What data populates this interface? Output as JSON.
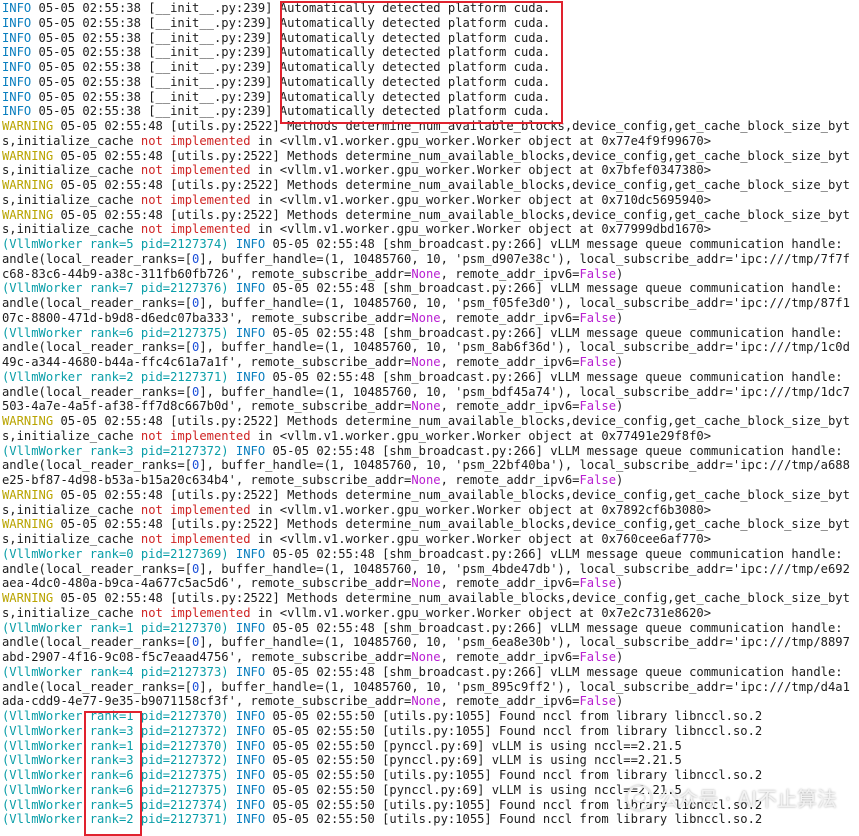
{
  "colors": {
    "default": "#1d1d1d",
    "info": "#0a7fbf",
    "warning": "#b9a400",
    "worker": "#0a9ea8",
    "not_implemented": "#cf2424",
    "number": "#1c50d8",
    "none_false": "#b81fd1",
    "highlight_box": "#e0222e"
  },
  "terminal_lines": [
    [
      [
        "c-info",
        "INFO"
      ],
      [
        "c-default",
        " 05-05 02:55:38 [__init__.py:239] Automatically detected platform cuda."
      ]
    ],
    [
      [
        "c-info",
        "INFO"
      ],
      [
        "c-default",
        " 05-05 02:55:38 [__init__.py:239] Automatically detected platform cuda."
      ]
    ],
    [
      [
        "c-info",
        "INFO"
      ],
      [
        "c-default",
        " 05-05 02:55:38 [__init__.py:239] Automatically detected platform cuda."
      ]
    ],
    [
      [
        "c-info",
        "INFO"
      ],
      [
        "c-default",
        " 05-05 02:55:38 [__init__.py:239] Automatically detected platform cuda."
      ]
    ],
    [
      [
        "c-info",
        "INFO"
      ],
      [
        "c-default",
        " 05-05 02:55:38 [__init__.py:239] Automatically detected platform cuda."
      ]
    ],
    [
      [
        "c-info",
        "INFO"
      ],
      [
        "c-default",
        " 05-05 02:55:38 [__init__.py:239] Automatically detected platform cuda."
      ]
    ],
    [
      [
        "c-info",
        "INFO"
      ],
      [
        "c-default",
        " 05-05 02:55:38 [__init__.py:239] Automatically detected platform cuda."
      ]
    ],
    [
      [
        "c-info",
        "INFO"
      ],
      [
        "c-default",
        " 05-05 02:55:38 [__init__.py:239] Automatically detected platform cuda."
      ]
    ],
    [
      [
        "c-warn",
        "WARNING"
      ],
      [
        "c-default",
        " 05-05 02:55:48 [utils.py:2522] Methods determine_num_available_blocks,device_config,get_cache_block_size_byt"
      ]
    ],
    [
      [
        "c-default",
        "s,initialize_cache "
      ],
      [
        "c-red",
        "not implemented"
      ],
      [
        "c-default",
        " in <vllm.v1.worker.gpu_worker.Worker object at 0x77e4f9f99670>"
      ]
    ],
    [
      [
        "c-warn",
        "WARNING"
      ],
      [
        "c-default",
        " 05-05 02:55:48 [utils.py:2522] Methods determine_num_available_blocks,device_config,get_cache_block_size_byt"
      ]
    ],
    [
      [
        "c-default",
        "s,initialize_cache "
      ],
      [
        "c-red",
        "not implemented"
      ],
      [
        "c-default",
        " in <vllm.v1.worker.gpu_worker.Worker object at 0x7bfef0347380>"
      ]
    ],
    [
      [
        "c-warn",
        "WARNING"
      ],
      [
        "c-default",
        " 05-05 02:55:48 [utils.py:2522] Methods determine_num_available_blocks,device_config,get_cache_block_size_byt"
      ]
    ],
    [
      [
        "c-default",
        "s,initialize_cache "
      ],
      [
        "c-red",
        "not implemented"
      ],
      [
        "c-default",
        " in <vllm.v1.worker.gpu_worker.Worker object at 0x710dc5695940>"
      ]
    ],
    [
      [
        "c-warn",
        "WARNING"
      ],
      [
        "c-default",
        " 05-05 02:55:48 [utils.py:2522] Methods determine_num_available_blocks,device_config,get_cache_block_size_byt"
      ]
    ],
    [
      [
        "c-default",
        "s,initialize_cache "
      ],
      [
        "c-red",
        "not implemented"
      ],
      [
        "c-default",
        " in <vllm.v1.worker.gpu_worker.Worker object at 0x77999dbd1670>"
      ]
    ],
    [
      [
        "c-worker",
        "(VllmWorker rank=5 pid=2127374)"
      ],
      [
        "c-default",
        " "
      ],
      [
        "c-info",
        "INFO"
      ],
      [
        "c-default",
        " 05-05 02:55:48 [shm_broadcast.py:266] vLLM message queue communication handle:"
      ]
    ],
    [
      [
        "c-default",
        "andle(local_reader_ranks=["
      ],
      [
        "c-num",
        "0"
      ],
      [
        "c-default",
        "], buffer_handle=(1, 10485760, 10, 'psm_d907e38c'), local_subscribe_addr='ipc:///tmp/7f7f"
      ]
    ],
    [
      [
        "c-default",
        "c68-83c6-44b9-a38c-311fb60fb726', remote_subscribe_addr="
      ],
      [
        "c-mag",
        "None"
      ],
      [
        "c-default",
        ", remote_addr_ipv6="
      ],
      [
        "c-mag",
        "False"
      ],
      [
        "c-default",
        ")"
      ]
    ],
    [
      [
        "c-worker",
        "(VllmWorker rank=7 pid=2127376)"
      ],
      [
        "c-default",
        " "
      ],
      [
        "c-info",
        "INFO"
      ],
      [
        "c-default",
        " 05-05 02:55:48 [shm_broadcast.py:266] vLLM message queue communication handle:"
      ]
    ],
    [
      [
        "c-default",
        "andle(local_reader_ranks=["
      ],
      [
        "c-num",
        "0"
      ],
      [
        "c-default",
        "], buffer_handle=(1, 10485760, 10, 'psm_f05fe3d0'), local_subscribe_addr='ipc:///tmp/87f1"
      ]
    ],
    [
      [
        "c-default",
        "07c-8800-471d-b9d8-d6edc07ba333', remote_subscribe_addr="
      ],
      [
        "c-mag",
        "None"
      ],
      [
        "c-default",
        ", remote_addr_ipv6="
      ],
      [
        "c-mag",
        "False"
      ],
      [
        "c-default",
        ")"
      ]
    ],
    [
      [
        "c-worker",
        "(VllmWorker rank=6 pid=2127375)"
      ],
      [
        "c-default",
        " "
      ],
      [
        "c-info",
        "INFO"
      ],
      [
        "c-default",
        " 05-05 02:55:48 [shm_broadcast.py:266] vLLM message queue communication handle:"
      ]
    ],
    [
      [
        "c-default",
        "andle(local_reader_ranks=["
      ],
      [
        "c-num",
        "0"
      ],
      [
        "c-default",
        "], buffer_handle=(1, 10485760, 10, 'psm_8ab6f36d'), local_subscribe_addr='ipc:///tmp/1c0d"
      ]
    ],
    [
      [
        "c-default",
        "49c-a344-4680-b44a-ffc4c61a7a1f', remote_subscribe_addr="
      ],
      [
        "c-mag",
        "None"
      ],
      [
        "c-default",
        ", remote_addr_ipv6="
      ],
      [
        "c-mag",
        "False"
      ],
      [
        "c-default",
        ")"
      ]
    ],
    [
      [
        "c-worker",
        "(VllmWorker rank=2 pid=2127371)"
      ],
      [
        "c-default",
        " "
      ],
      [
        "c-info",
        "INFO"
      ],
      [
        "c-default",
        " 05-05 02:55:48 [shm_broadcast.py:266] vLLM message queue communication handle:"
      ]
    ],
    [
      [
        "c-default",
        "andle(local_reader_ranks=["
      ],
      [
        "c-num",
        "0"
      ],
      [
        "c-default",
        "], buffer_handle=(1, 10485760, 10, 'psm_bdf45a74'), local_subscribe_addr='ipc:///tmp/1dc7"
      ]
    ],
    [
      [
        "c-default",
        "503-4a7e-4a5f-af38-ff7d8c667b0d', remote_subscribe_addr="
      ],
      [
        "c-mag",
        "None"
      ],
      [
        "c-default",
        ", remote_addr_ipv6="
      ],
      [
        "c-mag",
        "False"
      ],
      [
        "c-default",
        ")"
      ]
    ],
    [
      [
        "c-warn",
        "WARNING"
      ],
      [
        "c-default",
        " 05-05 02:55:48 [utils.py:2522] Methods determine_num_available_blocks,device_config,get_cache_block_size_byt"
      ]
    ],
    [
      [
        "c-default",
        "s,initialize_cache "
      ],
      [
        "c-red",
        "not implemented"
      ],
      [
        "c-default",
        " in <vllm.v1.worker.gpu_worker.Worker object at 0x77491e29f8f0>"
      ]
    ],
    [
      [
        "c-worker",
        "(VllmWorker rank=3 pid=2127372)"
      ],
      [
        "c-default",
        " "
      ],
      [
        "c-info",
        "INFO"
      ],
      [
        "c-default",
        " 05-05 02:55:48 [shm_broadcast.py:266] vLLM message queue communication handle:"
      ]
    ],
    [
      [
        "c-default",
        "andle(local_reader_ranks=["
      ],
      [
        "c-num",
        "0"
      ],
      [
        "c-default",
        "], buffer_handle=(1, 10485760, 10, 'psm_22bf40ba'), local_subscribe_addr='ipc:///tmp/a688"
      ]
    ],
    [
      [
        "c-default",
        "e25-bf87-4d98-b53a-b15a20c634b4', remote_subscribe_addr="
      ],
      [
        "c-mag",
        "None"
      ],
      [
        "c-default",
        ", remote_addr_ipv6="
      ],
      [
        "c-mag",
        "False"
      ],
      [
        "c-default",
        ")"
      ]
    ],
    [
      [
        "c-warn",
        "WARNING"
      ],
      [
        "c-default",
        " 05-05 02:55:48 [utils.py:2522] Methods determine_num_available_blocks,device_config,get_cache_block_size_byt"
      ]
    ],
    [
      [
        "c-default",
        "s,initialize_cache "
      ],
      [
        "c-red",
        "not implemented"
      ],
      [
        "c-default",
        " in <vllm.v1.worker.gpu_worker.Worker object at 0x7892cf6b3080>"
      ]
    ],
    [
      [
        "c-warn",
        "WARNING"
      ],
      [
        "c-default",
        " 05-05 02:55:48 [utils.py:2522] Methods determine_num_available_blocks,device_config,get_cache_block_size_byt"
      ]
    ],
    [
      [
        "c-default",
        "s,initialize_cache "
      ],
      [
        "c-red",
        "not implemented"
      ],
      [
        "c-default",
        " in <vllm.v1.worker.gpu_worker.Worker object at 0x760cee6af770>"
      ]
    ],
    [
      [
        "c-worker",
        "(VllmWorker rank=0 pid=2127369)"
      ],
      [
        "c-default",
        " "
      ],
      [
        "c-info",
        "INFO"
      ],
      [
        "c-default",
        " 05-05 02:55:48 [shm_broadcast.py:266] vLLM message queue communication handle:"
      ]
    ],
    [
      [
        "c-default",
        "andle(local_reader_ranks=["
      ],
      [
        "c-num",
        "0"
      ],
      [
        "c-default",
        "], buffer_handle=(1, 10485760, 10, 'psm_4bde47db'), local_subscribe_addr='ipc:///tmp/e692"
      ]
    ],
    [
      [
        "c-default",
        "aea-4dc0-480a-b9ca-4a677c5ac5d6', remote_subscribe_addr="
      ],
      [
        "c-mag",
        "None"
      ],
      [
        "c-default",
        ", remote_addr_ipv6="
      ],
      [
        "c-mag",
        "False"
      ],
      [
        "c-default",
        ")"
      ]
    ],
    [
      [
        "c-warn",
        "WARNING"
      ],
      [
        "c-default",
        " 05-05 02:55:48 [utils.py:2522] Methods determine_num_available_blocks,device_config,get_cache_block_size_byt"
      ]
    ],
    [
      [
        "c-default",
        "s,initialize_cache "
      ],
      [
        "c-red",
        "not implemented"
      ],
      [
        "c-default",
        " in <vllm.v1.worker.gpu_worker.Worker object at 0x7e2c731e8620>"
      ]
    ],
    [
      [
        "c-worker",
        "(VllmWorker rank=1 pid=2127370)"
      ],
      [
        "c-default",
        " "
      ],
      [
        "c-info",
        "INFO"
      ],
      [
        "c-default",
        " 05-05 02:55:48 [shm_broadcast.py:266] vLLM message queue communication handle:"
      ]
    ],
    [
      [
        "c-default",
        "andle(local_reader_ranks=["
      ],
      [
        "c-num",
        "0"
      ],
      [
        "c-default",
        "], buffer_handle=(1, 10485760, 10, 'psm_6ea8e30b'), local_subscribe_addr='ipc:///tmp/8897"
      ]
    ],
    [
      [
        "c-default",
        "abd-2907-4f16-9c08-f5c7eaad4756', remote_subscribe_addr="
      ],
      [
        "c-mag",
        "None"
      ],
      [
        "c-default",
        ", remote_addr_ipv6="
      ],
      [
        "c-mag",
        "False"
      ],
      [
        "c-default",
        ")"
      ]
    ],
    [
      [
        "c-worker",
        "(VllmWorker rank=4 pid=2127373)"
      ],
      [
        "c-default",
        " "
      ],
      [
        "c-info",
        "INFO"
      ],
      [
        "c-default",
        " 05-05 02:55:48 [shm_broadcast.py:266] vLLM message queue communication handle:"
      ]
    ],
    [
      [
        "c-default",
        "andle(local_reader_ranks=["
      ],
      [
        "c-num",
        "0"
      ],
      [
        "c-default",
        "], buffer_handle=(1, 10485760, 10, 'psm_895c9ff2'), local_subscribe_addr='ipc:///tmp/d4a1"
      ]
    ],
    [
      [
        "c-default",
        "ada-cdd9-4e77-9e35-b9071158cf3f', remote_subscribe_addr="
      ],
      [
        "c-mag",
        "None"
      ],
      [
        "c-default",
        ", remote_addr_ipv6="
      ],
      [
        "c-mag",
        "False"
      ],
      [
        "c-default",
        ")"
      ]
    ],
    [
      [
        "c-worker",
        "(VllmWorker rank=1 pid=2127370)"
      ],
      [
        "c-default",
        " "
      ],
      [
        "c-info",
        "INFO"
      ],
      [
        "c-default",
        " 05-05 02:55:50 [utils.py:1055] Found nccl from library libnccl.so.2"
      ]
    ],
    [
      [
        "c-worker",
        "(VllmWorker rank=3 pid=2127372)"
      ],
      [
        "c-default",
        " "
      ],
      [
        "c-info",
        "INFO"
      ],
      [
        "c-default",
        " 05-05 02:55:50 [utils.py:1055] Found nccl from library libnccl.so.2"
      ]
    ],
    [
      [
        "c-worker",
        "(VllmWorker rank=1 pid=2127370)"
      ],
      [
        "c-default",
        " "
      ],
      [
        "c-info",
        "INFO"
      ],
      [
        "c-default",
        " 05-05 02:55:50 [pynccl.py:69] vLLM is using nccl==2.21.5"
      ]
    ],
    [
      [
        "c-worker",
        "(VllmWorker rank=3 pid=2127372)"
      ],
      [
        "c-default",
        " "
      ],
      [
        "c-info",
        "INFO"
      ],
      [
        "c-default",
        " 05-05 02:55:50 [pynccl.py:69] vLLM is using nccl==2.21.5"
      ]
    ],
    [
      [
        "c-worker",
        "(VllmWorker rank=6 pid=2127375)"
      ],
      [
        "c-default",
        " "
      ],
      [
        "c-info",
        "INFO"
      ],
      [
        "c-default",
        " 05-05 02:55:50 [utils.py:1055] Found nccl from library libnccl.so.2"
      ]
    ],
    [
      [
        "c-worker",
        "(VllmWorker rank=6 pid=2127375)"
      ],
      [
        "c-default",
        " "
      ],
      [
        "c-info",
        "INFO"
      ],
      [
        "c-default",
        " 05-05 02:55:50 [pynccl.py:69] vLLM is using nccl==2.21.5"
      ]
    ],
    [
      [
        "c-worker",
        "(VllmWorker rank=5 pid=2127374)"
      ],
      [
        "c-default",
        " "
      ],
      [
        "c-info",
        "INFO"
      ],
      [
        "c-default",
        " 05-05 02:55:50 [utils.py:1055] Found nccl from library libnccl.so.2"
      ]
    ],
    [
      [
        "c-worker",
        "(VllmWorker rank=2 pid=2127371)"
      ],
      [
        "c-default",
        " "
      ],
      [
        "c-info",
        "INFO"
      ],
      [
        "c-default",
        " 05-05 02:55:50 [utils.py:1055] Found nccl from library libnccl.so.2"
      ]
    ]
  ],
  "watermark": {
    "icon": "wechat-icon",
    "text": "公众号 · AI不止算法"
  }
}
